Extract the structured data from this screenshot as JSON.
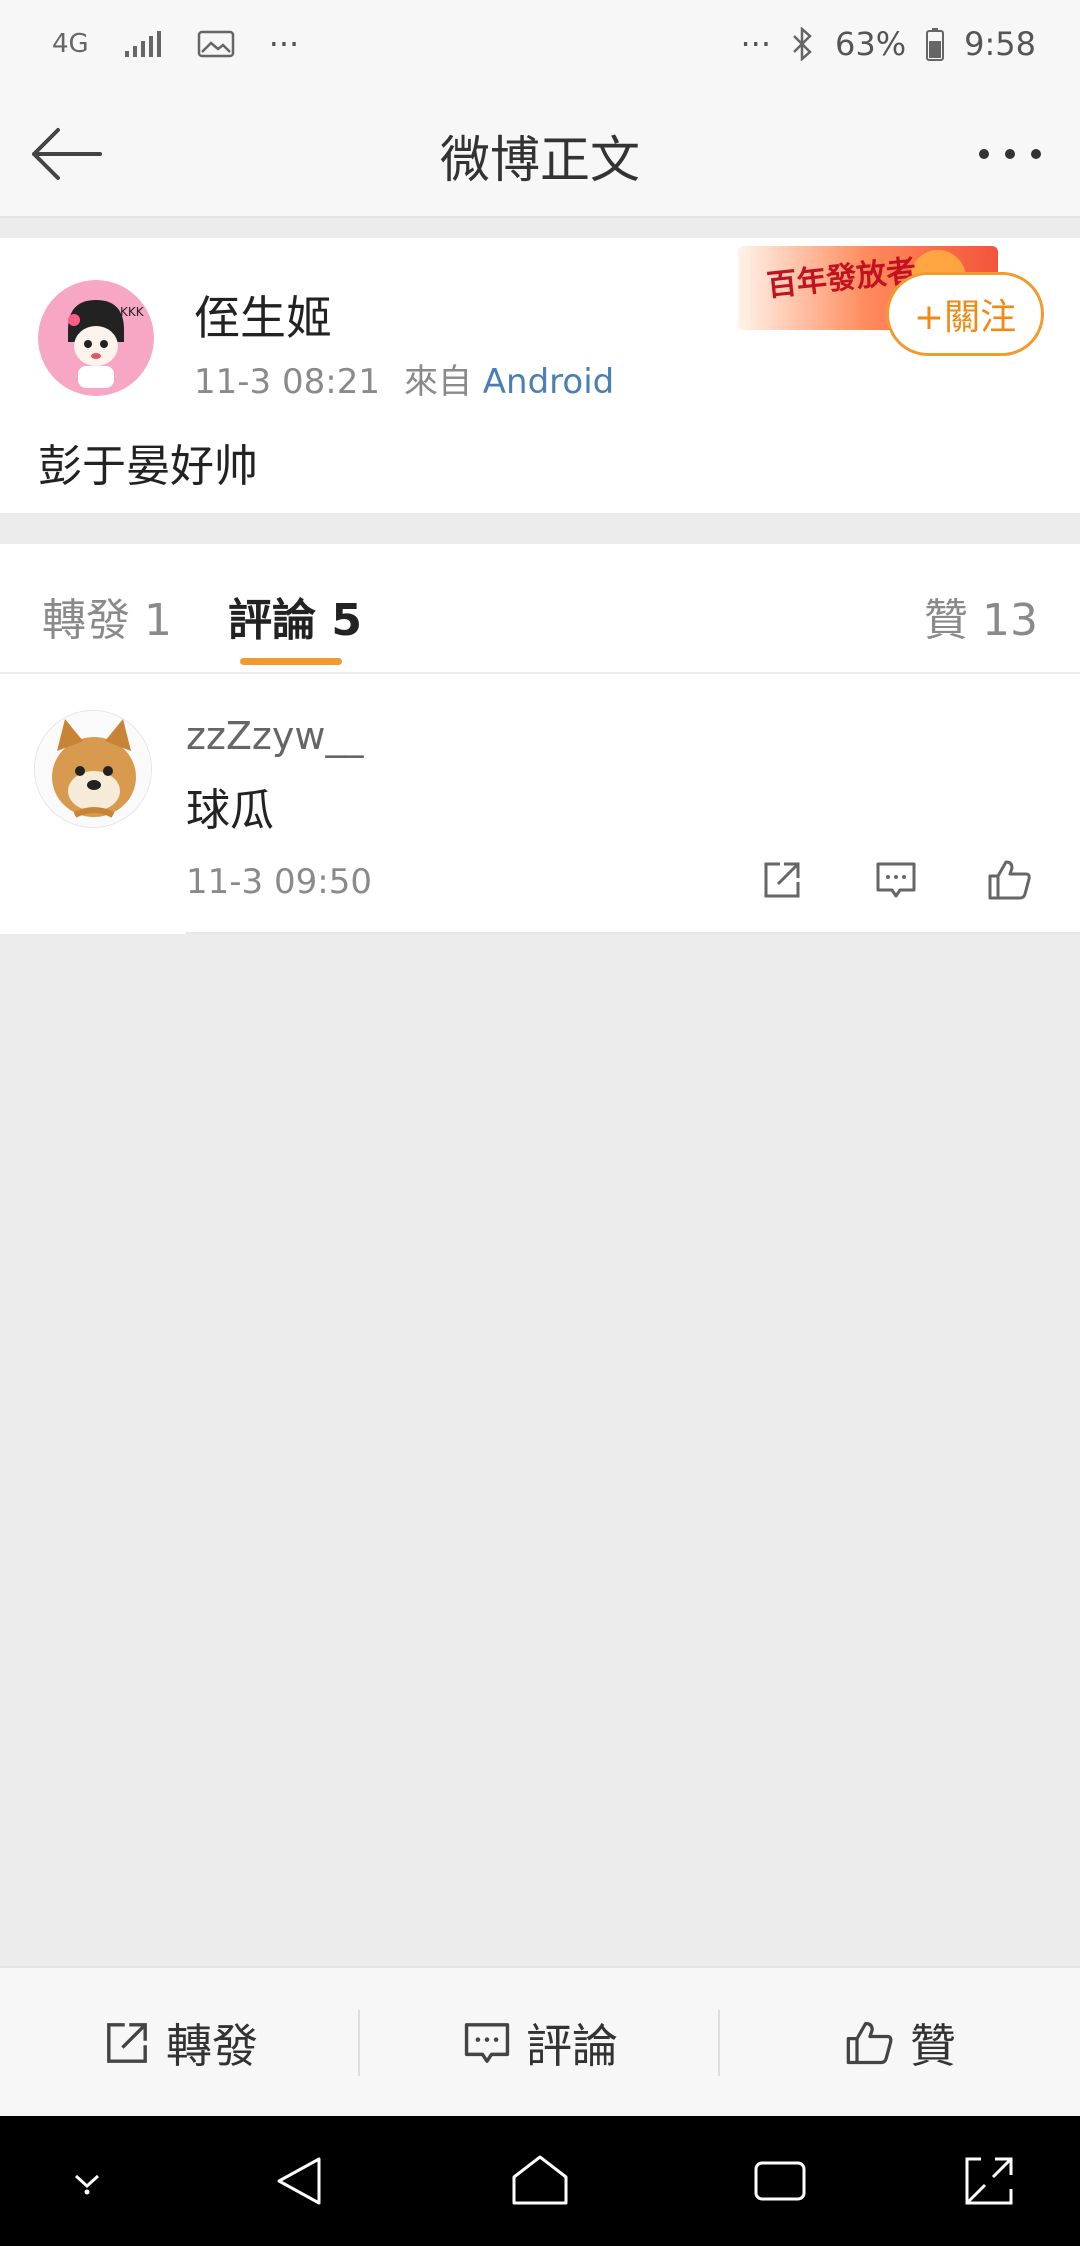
{
  "status_bar": {
    "network": "4G",
    "more_left": "···",
    "more_right": "···",
    "battery": "63%",
    "time": "9:58"
  },
  "nav": {
    "title": "微博正文"
  },
  "post": {
    "author": "侄生姬",
    "time": "11-3 08:21",
    "source_prefix": "來自",
    "source": "Android",
    "follow_label": "+關注",
    "banner_text": "百年發放者",
    "text": "彭于晏好帅"
  },
  "tabs": {
    "repost": "轉發 1",
    "comment": "評論 5",
    "like": "贊 13"
  },
  "comments": [
    {
      "user": "zzZzyw__",
      "text": "球瓜",
      "time": "11-3 09:50"
    }
  ],
  "actions": {
    "repost": "轉發",
    "comment": "評論",
    "like": "贊"
  },
  "colors": {
    "accent": "#f19a2e",
    "link": "#4a7fb5",
    "page_bg": "#ececec"
  },
  "icons": [
    "back-arrow-icon",
    "more-dots-icon",
    "share-icon",
    "comment-icon",
    "like-icon",
    "nav-back-icon",
    "nav-home-icon",
    "nav-recent-icon",
    "nav-rotate-icon",
    "nav-dropdown-icon"
  ]
}
